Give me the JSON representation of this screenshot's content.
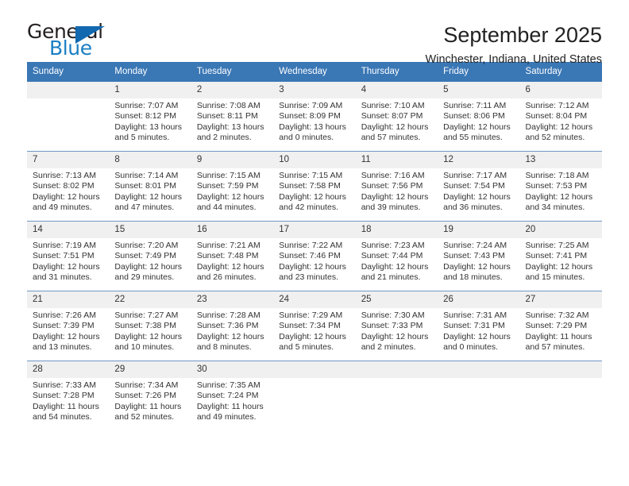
{
  "brand": {
    "name_top": "General",
    "name_bottom": "Blue",
    "accent_color": "#1269b0",
    "text_color": "#231f20"
  },
  "header": {
    "title": "September 2025",
    "location": "Winchester, Indiana, United States"
  },
  "calendar": {
    "header_bg": "#3a77b5",
    "header_text_color": "#ffffff",
    "daynum_bg": "#f0f0f0",
    "weekdays": [
      "Sunday",
      "Monday",
      "Tuesday",
      "Wednesday",
      "Thursday",
      "Friday",
      "Saturday"
    ],
    "weeks": [
      [
        {
          "day": "",
          "sunrise": "",
          "sunset": "",
          "daylight1": "",
          "daylight2": "",
          "blank": true
        },
        {
          "day": "1",
          "sunrise": "Sunrise: 7:07 AM",
          "sunset": "Sunset: 8:12 PM",
          "daylight1": "Daylight: 13 hours",
          "daylight2": "and 5 minutes."
        },
        {
          "day": "2",
          "sunrise": "Sunrise: 7:08 AM",
          "sunset": "Sunset: 8:11 PM",
          "daylight1": "Daylight: 13 hours",
          "daylight2": "and 2 minutes."
        },
        {
          "day": "3",
          "sunrise": "Sunrise: 7:09 AM",
          "sunset": "Sunset: 8:09 PM",
          "daylight1": "Daylight: 13 hours",
          "daylight2": "and 0 minutes."
        },
        {
          "day": "4",
          "sunrise": "Sunrise: 7:10 AM",
          "sunset": "Sunset: 8:07 PM",
          "daylight1": "Daylight: 12 hours",
          "daylight2": "and 57 minutes."
        },
        {
          "day": "5",
          "sunrise": "Sunrise: 7:11 AM",
          "sunset": "Sunset: 8:06 PM",
          "daylight1": "Daylight: 12 hours",
          "daylight2": "and 55 minutes."
        },
        {
          "day": "6",
          "sunrise": "Sunrise: 7:12 AM",
          "sunset": "Sunset: 8:04 PM",
          "daylight1": "Daylight: 12 hours",
          "daylight2": "and 52 minutes."
        }
      ],
      [
        {
          "day": "7",
          "sunrise": "Sunrise: 7:13 AM",
          "sunset": "Sunset: 8:02 PM",
          "daylight1": "Daylight: 12 hours",
          "daylight2": "and 49 minutes."
        },
        {
          "day": "8",
          "sunrise": "Sunrise: 7:14 AM",
          "sunset": "Sunset: 8:01 PM",
          "daylight1": "Daylight: 12 hours",
          "daylight2": "and 47 minutes."
        },
        {
          "day": "9",
          "sunrise": "Sunrise: 7:15 AM",
          "sunset": "Sunset: 7:59 PM",
          "daylight1": "Daylight: 12 hours",
          "daylight2": "and 44 minutes."
        },
        {
          "day": "10",
          "sunrise": "Sunrise: 7:15 AM",
          "sunset": "Sunset: 7:58 PM",
          "daylight1": "Daylight: 12 hours",
          "daylight2": "and 42 minutes."
        },
        {
          "day": "11",
          "sunrise": "Sunrise: 7:16 AM",
          "sunset": "Sunset: 7:56 PM",
          "daylight1": "Daylight: 12 hours",
          "daylight2": "and 39 minutes."
        },
        {
          "day": "12",
          "sunrise": "Sunrise: 7:17 AM",
          "sunset": "Sunset: 7:54 PM",
          "daylight1": "Daylight: 12 hours",
          "daylight2": "and 36 minutes."
        },
        {
          "day": "13",
          "sunrise": "Sunrise: 7:18 AM",
          "sunset": "Sunset: 7:53 PM",
          "daylight1": "Daylight: 12 hours",
          "daylight2": "and 34 minutes."
        }
      ],
      [
        {
          "day": "14",
          "sunrise": "Sunrise: 7:19 AM",
          "sunset": "Sunset: 7:51 PM",
          "daylight1": "Daylight: 12 hours",
          "daylight2": "and 31 minutes."
        },
        {
          "day": "15",
          "sunrise": "Sunrise: 7:20 AM",
          "sunset": "Sunset: 7:49 PM",
          "daylight1": "Daylight: 12 hours",
          "daylight2": "and 29 minutes."
        },
        {
          "day": "16",
          "sunrise": "Sunrise: 7:21 AM",
          "sunset": "Sunset: 7:48 PM",
          "daylight1": "Daylight: 12 hours",
          "daylight2": "and 26 minutes."
        },
        {
          "day": "17",
          "sunrise": "Sunrise: 7:22 AM",
          "sunset": "Sunset: 7:46 PM",
          "daylight1": "Daylight: 12 hours",
          "daylight2": "and 23 minutes."
        },
        {
          "day": "18",
          "sunrise": "Sunrise: 7:23 AM",
          "sunset": "Sunset: 7:44 PM",
          "daylight1": "Daylight: 12 hours",
          "daylight2": "and 21 minutes."
        },
        {
          "day": "19",
          "sunrise": "Sunrise: 7:24 AM",
          "sunset": "Sunset: 7:43 PM",
          "daylight1": "Daylight: 12 hours",
          "daylight2": "and 18 minutes."
        },
        {
          "day": "20",
          "sunrise": "Sunrise: 7:25 AM",
          "sunset": "Sunset: 7:41 PM",
          "daylight1": "Daylight: 12 hours",
          "daylight2": "and 15 minutes."
        }
      ],
      [
        {
          "day": "21",
          "sunrise": "Sunrise: 7:26 AM",
          "sunset": "Sunset: 7:39 PM",
          "daylight1": "Daylight: 12 hours",
          "daylight2": "and 13 minutes."
        },
        {
          "day": "22",
          "sunrise": "Sunrise: 7:27 AM",
          "sunset": "Sunset: 7:38 PM",
          "daylight1": "Daylight: 12 hours",
          "daylight2": "and 10 minutes."
        },
        {
          "day": "23",
          "sunrise": "Sunrise: 7:28 AM",
          "sunset": "Sunset: 7:36 PM",
          "daylight1": "Daylight: 12 hours",
          "daylight2": "and 8 minutes."
        },
        {
          "day": "24",
          "sunrise": "Sunrise: 7:29 AM",
          "sunset": "Sunset: 7:34 PM",
          "daylight1": "Daylight: 12 hours",
          "daylight2": "and 5 minutes."
        },
        {
          "day": "25",
          "sunrise": "Sunrise: 7:30 AM",
          "sunset": "Sunset: 7:33 PM",
          "daylight1": "Daylight: 12 hours",
          "daylight2": "and 2 minutes."
        },
        {
          "day": "26",
          "sunrise": "Sunrise: 7:31 AM",
          "sunset": "Sunset: 7:31 PM",
          "daylight1": "Daylight: 12 hours",
          "daylight2": "and 0 minutes."
        },
        {
          "day": "27",
          "sunrise": "Sunrise: 7:32 AM",
          "sunset": "Sunset: 7:29 PM",
          "daylight1": "Daylight: 11 hours",
          "daylight2": "and 57 minutes."
        }
      ],
      [
        {
          "day": "28",
          "sunrise": "Sunrise: 7:33 AM",
          "sunset": "Sunset: 7:28 PM",
          "daylight1": "Daylight: 11 hours",
          "daylight2": "and 54 minutes."
        },
        {
          "day": "29",
          "sunrise": "Sunrise: 7:34 AM",
          "sunset": "Sunset: 7:26 PM",
          "daylight1": "Daylight: 11 hours",
          "daylight2": "and 52 minutes."
        },
        {
          "day": "30",
          "sunrise": "Sunrise: 7:35 AM",
          "sunset": "Sunset: 7:24 PM",
          "daylight1": "Daylight: 11 hours",
          "daylight2": "and 49 minutes."
        },
        {
          "day": "",
          "sunrise": "",
          "sunset": "",
          "daylight1": "",
          "daylight2": "",
          "blank": true
        },
        {
          "day": "",
          "sunrise": "",
          "sunset": "",
          "daylight1": "",
          "daylight2": "",
          "blank": true
        },
        {
          "day": "",
          "sunrise": "",
          "sunset": "",
          "daylight1": "",
          "daylight2": "",
          "blank": true
        },
        {
          "day": "",
          "sunrise": "",
          "sunset": "",
          "daylight1": "",
          "daylight2": "",
          "blank": true
        }
      ]
    ]
  }
}
